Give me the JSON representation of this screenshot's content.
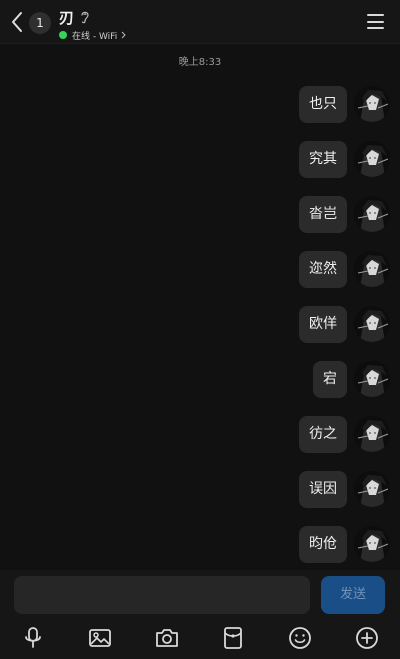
{
  "header": {
    "unread_count": "1",
    "title": "刃",
    "status_text": "在线 - WiFi",
    "status_color": "#37d35a"
  },
  "timestamp": "晚上8:33",
  "messages": [
    {
      "text": "也只"
    },
    {
      "text": "究其"
    },
    {
      "text": "沓岂"
    },
    {
      "text": "迩然"
    },
    {
      "text": "欧佯"
    },
    {
      "text": "宕"
    },
    {
      "text": "彷之"
    },
    {
      "text": "误因"
    },
    {
      "text": "昀伧"
    }
  ],
  "input": {
    "value": "",
    "placeholder": ""
  },
  "send_button": {
    "label": "发送"
  },
  "toolbar": {
    "icons": [
      "microphone-icon",
      "image-icon",
      "camera-icon",
      "red-packet-icon",
      "emoji-icon",
      "plus-icon"
    ]
  },
  "colors": {
    "accent": "#1a4e86",
    "background": "#111111",
    "bubble": "#2b2b2b"
  }
}
